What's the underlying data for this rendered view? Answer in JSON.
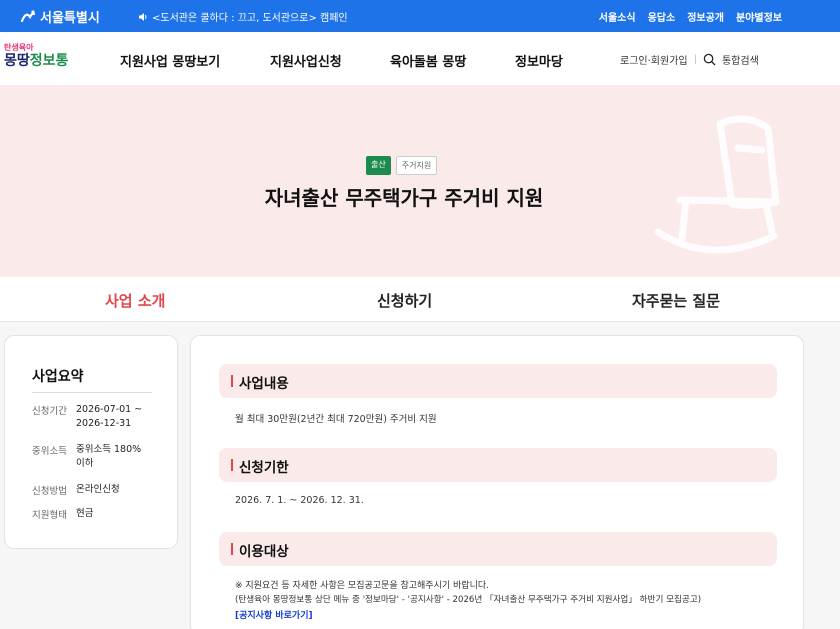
{
  "topbar": {
    "city_name": "서울특별시",
    "notice": "<도서관은 쿨하다 : 끄고, 도서관으로> 캠페인",
    "links": [
      "서울소식",
      "응답소",
      "정보공개",
      "분야별정보"
    ]
  },
  "header": {
    "brand_small": "탄생육아",
    "brand_part1": "몽땅",
    "brand_part2": "정보통",
    "nav": [
      "지원사업 몽땅보기",
      "지원사업신청",
      "육아돌봄 몽땅",
      "정보마당"
    ],
    "login": "로그인",
    "signup": "회원가입",
    "search": "통합검색"
  },
  "hero": {
    "badge_primary": "출산",
    "badge_secondary": "주거지원",
    "title": "자녀출산 무주택가구 주거비 지원"
  },
  "tabs": [
    "사업 소개",
    "신청하기",
    "자주묻는 질문"
  ],
  "summary": {
    "title": "사업요약",
    "rows": [
      {
        "key": "신청기간",
        "value": "2026-07-01 ~ 2026-12-31"
      },
      {
        "key": "중위소득",
        "value": "중위소득 180% 이하"
      },
      {
        "key": "신청방법",
        "value": "온라인신청"
      },
      {
        "key": "지원형태",
        "value": "현금"
      }
    ]
  },
  "sections": {
    "content_title": "사업내용",
    "content_text": "월 최대 30만원(2년간 최대 720만원) 주거비 지원",
    "period_title": "신청기한",
    "period_text": "2026. 7. 1. ~ 2026. 12. 31.",
    "target_title": "이용대상",
    "target_line1": "※ 지원요건 등 자세한 사항은 모집공고문을 참고해주시기 바랍니다.",
    "target_line2": "(탄생육아 몽땅정보통 상단 메뉴 중 '정보마당' - '공지사항' - 2026년 「자녀출산 무주택가구 주거비 지원사업」 하반기 모집공고)",
    "target_link": "[공지사항 바로가기]"
  },
  "colors": {
    "topbar": "#1e73e8",
    "accent_red": "#e2464b",
    "badge_green": "#1b8c4e",
    "hero_bg": "#fbeaea"
  }
}
